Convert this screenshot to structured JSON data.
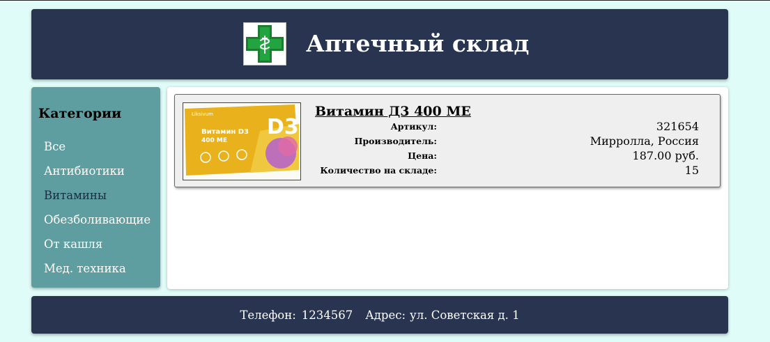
{
  "header": {
    "title": "Аптечный склад",
    "logo_icon": "pharmacy-cross-icon",
    "logo_colors": {
      "cross": "#1f9a3a",
      "snake": "#ffffff",
      "border": "#1c7d2f"
    }
  },
  "sidebar": {
    "heading": "Категории",
    "items": [
      {
        "label": "Все"
      },
      {
        "label": "Антибиотики"
      },
      {
        "label": "Витамины",
        "active": true
      },
      {
        "label": "Обезболивающие"
      },
      {
        "label": "От кашля"
      },
      {
        "label": "Мед. техника"
      }
    ]
  },
  "product": {
    "name": "Витамин Д3 400 МЕ",
    "image_brand": "Liksivum",
    "image_title": "Витамин D3",
    "image_dose": "400 МЕ",
    "image_big": "D3",
    "props": [
      {
        "label": "Артикул:",
        "value": "321654"
      },
      {
        "label": "Производитель:",
        "value": "Мирролла, Россия"
      },
      {
        "label": "Цена:",
        "value": "187.00 руб."
      },
      {
        "label": "Количество на складе:",
        "value": "15"
      }
    ]
  },
  "footer": {
    "phone_label": "Телефон:",
    "phone": "1234567",
    "address_label": "Адрес:",
    "address": "ул. Советская д. 1"
  },
  "colors": {
    "page_bg": "#e0fcf8",
    "header_bg": "#293550",
    "sidebar_bg": "#5f9ea0",
    "card_bg": "#efefef"
  }
}
